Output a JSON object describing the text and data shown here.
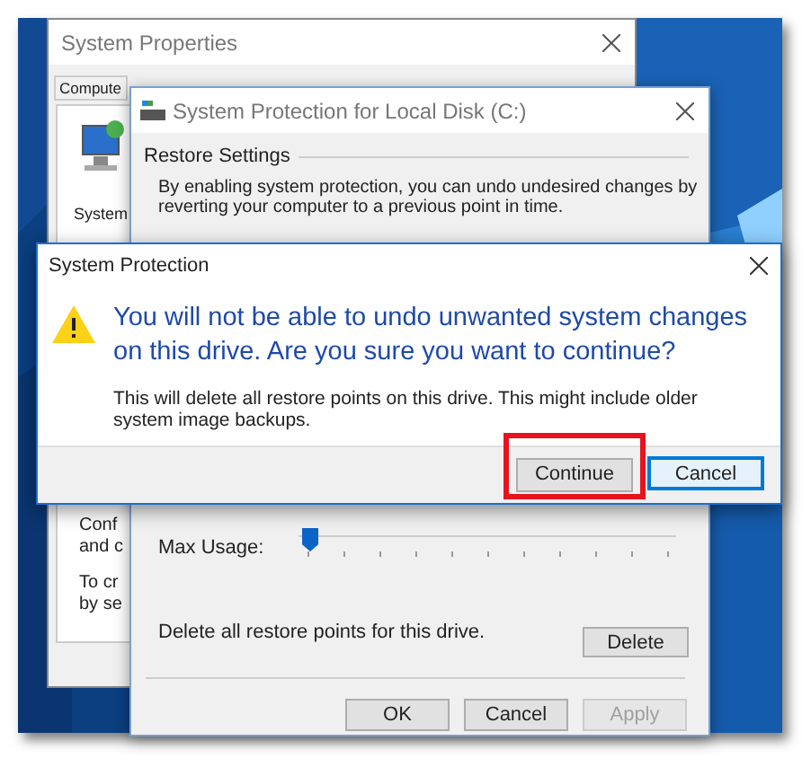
{
  "system_properties": {
    "title": "System Properties",
    "tabs": [
      {
        "label": "Compute",
        "selected": false
      }
    ],
    "side_texts": [
      "System",
      "Conf",
      "and c",
      "To cr",
      "by se"
    ]
  },
  "protection_window": {
    "title": "System Protection for Local Disk (C:)",
    "section": "Restore Settings",
    "description": "By enabling system protection, you can undo undesired changes by reverting your computer to a previous point in time.",
    "max_usage": {
      "label": "Max Usage:",
      "level": 0.01
    },
    "delete_text": "Delete all restore points for this drive.",
    "delete_button": "Delete",
    "buttons": [
      {
        "label": "OK",
        "disabled": false
      },
      {
        "label": "Cancel",
        "disabled": false
      },
      {
        "label": "Apply",
        "disabled": true
      }
    ]
  },
  "alert": {
    "title": "System Protection",
    "message": "You will not be able to undo unwanted system changes on this drive. Are you sure you want to continue?",
    "detail": "This will delete all restore points on this drive. This might include older system image backups.",
    "buttons": [
      {
        "label": "Continue",
        "highlighted": true,
        "focused": false
      },
      {
        "label": "Cancel",
        "highlighted": false,
        "focused": true
      }
    ]
  }
}
